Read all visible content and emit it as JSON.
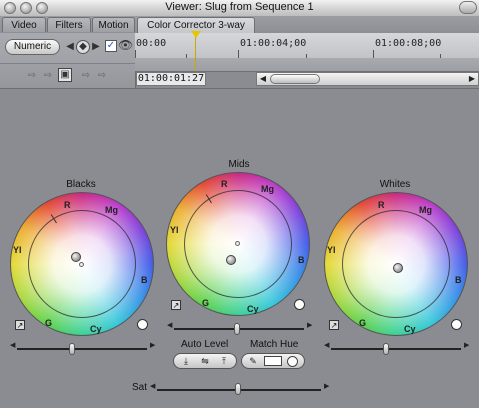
{
  "window": {
    "title": "Viewer: Slug from Sequence 1"
  },
  "tabs": [
    {
      "label": "Video"
    },
    {
      "label": "Filters"
    },
    {
      "label": "Motion"
    },
    {
      "label": "Color Corrector 3-way",
      "active": true
    }
  ],
  "toolbar": {
    "numeric_label": "Numeric"
  },
  "timeline": {
    "timecodes": [
      "00:00",
      "01:00:04;00",
      "01:00:08;00"
    ],
    "current_timecode": "01:00:01:27"
  },
  "wheels": [
    {
      "id": "blacks",
      "title": "Blacks",
      "labels": {
        "R": "R",
        "Mg": "Mg",
        "B": "B",
        "Cy": "Cy",
        "G": "G",
        "Yl": "Yl"
      }
    },
    {
      "id": "mids",
      "title": "Mids",
      "labels": {
        "R": "R",
        "Mg": "Mg",
        "B": "B",
        "Cy": "Cy",
        "G": "G",
        "Yl": "Yl"
      }
    },
    {
      "id": "whites",
      "title": "Whites",
      "labels": {
        "R": "R",
        "Mg": "Mg",
        "B": "B",
        "Cy": "Cy",
        "G": "G",
        "Yl": "Yl"
      }
    }
  ],
  "controls": {
    "auto_level_label": "Auto Level",
    "match_hue_label": "Match Hue",
    "sat_label": "Sat"
  },
  "colors": {
    "background": "#8a8c91",
    "playhead": "#e7c400"
  },
  "icons": [
    "eye-icon",
    "checkbox-icon",
    "keyframe-nav-icon",
    "eyedropper-icon",
    "reset-icon"
  ]
}
